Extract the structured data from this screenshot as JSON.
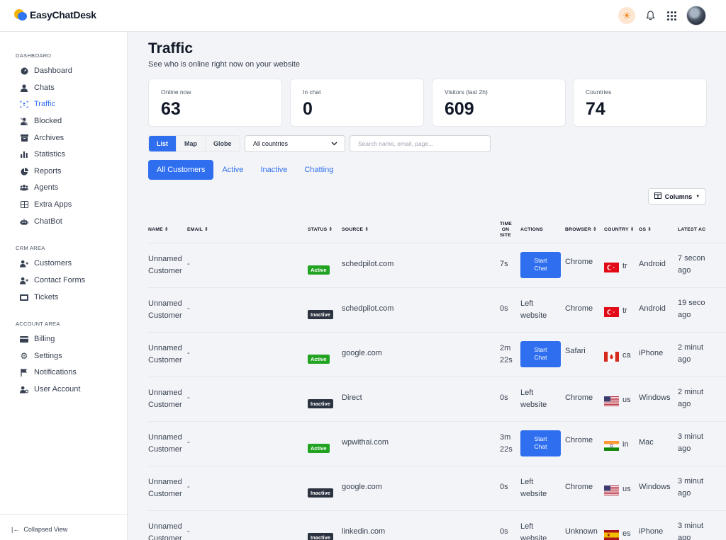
{
  "app": {
    "name": "EasyChatDesk"
  },
  "sidebar": {
    "sections": [
      {
        "title": "DASHBOARD",
        "items": [
          {
            "label": "Dashboard",
            "icon": "gauge-icon"
          },
          {
            "label": "Chats",
            "icon": "user-icon"
          },
          {
            "label": "Traffic",
            "icon": "traffic-icon",
            "active": true
          },
          {
            "label": "Blocked",
            "icon": "user-slash-icon"
          },
          {
            "label": "Archives",
            "icon": "archive-icon"
          },
          {
            "label": "Statistics",
            "icon": "bar-chart-icon"
          },
          {
            "label": "Reports",
            "icon": "pie-chart-icon"
          },
          {
            "label": "Agents",
            "icon": "users-icon"
          },
          {
            "label": "Extra Apps",
            "icon": "grid-box-icon"
          },
          {
            "label": "ChatBot",
            "icon": "robot-icon"
          }
        ]
      },
      {
        "title": "CRM AREA",
        "items": [
          {
            "label": "Customers",
            "icon": "user-plus-icon"
          },
          {
            "label": "Contact Forms",
            "icon": "user-plus-icon"
          },
          {
            "label": "Tickets",
            "icon": "ticket-icon"
          }
        ]
      },
      {
        "title": "ACCOUNT AREA",
        "items": [
          {
            "label": "Billing",
            "icon": "credit-card-icon"
          },
          {
            "label": "Settings",
            "icon": "gear-icon"
          },
          {
            "label": "Notifications",
            "icon": "flag-icon"
          },
          {
            "label": "User Account",
            "icon": "user-gear-icon"
          }
        ]
      }
    ],
    "collapse_label": "Collapsed View"
  },
  "page": {
    "title": "Traffic",
    "subtitle": "See who is online right now on your website"
  },
  "stats": [
    {
      "label": "Online now",
      "value": "63"
    },
    {
      "label": "In chat",
      "value": "0"
    },
    {
      "label": "Visitors (last 2h)",
      "value": "609"
    },
    {
      "label": "Countries",
      "value": "74"
    }
  ],
  "view_toggle": {
    "list": "List",
    "map": "Map",
    "globe": "Globe"
  },
  "country_filter": {
    "value": "All countries"
  },
  "search": {
    "placeholder": "Search name, email, page..."
  },
  "tabs": {
    "all": "All Customers",
    "active": "Active",
    "inactive": "Inactive",
    "chatting": "Chatting"
  },
  "columns_button": "Columns",
  "table": {
    "headers": {
      "name": "NAME ⇕",
      "email": "EMAIL ⇕",
      "status": "STATUS ⇕",
      "source": "SOURCE ⇕",
      "time1": "TIME",
      "time2": "ON",
      "time3": "SITE",
      "actions": "ACTIONS",
      "browser": "BROWSER ⇕",
      "country": "COUNTRY ⇕",
      "os": "OS ⇕",
      "latest": "LATEST AC"
    },
    "rows": [
      {
        "name1": "Unnamed",
        "name2": "Customer",
        "email": "-",
        "status": "Active",
        "source": "schedpilot.com",
        "time1": "7s",
        "time2": "",
        "action1": "Start",
        "action2": "Chat",
        "browser": "Chrome",
        "country": "tr",
        "os": "Android",
        "latest1": "7 secon",
        "latest2": "ago"
      },
      {
        "name1": "Unnamed",
        "name2": "Customer",
        "email": "-",
        "status": "Inactive",
        "source": "schedpilot.com",
        "time1": "0s",
        "time2": "",
        "action1": "Left",
        "action2": "website",
        "browser": "Chrome",
        "country": "tr",
        "os": "Android",
        "latest1": "19 seco",
        "latest2": "ago"
      },
      {
        "name1": "Unnamed",
        "name2": "Customer",
        "email": "-",
        "status": "Active",
        "source": "google.com",
        "time1": "2m",
        "time2": "22s",
        "action1": "Start",
        "action2": "Chat",
        "browser": "Safari",
        "country": "ca",
        "os": "iPhone",
        "latest1": "2 minut",
        "latest2": "ago"
      },
      {
        "name1": "Unnamed",
        "name2": "Customer",
        "email": "-",
        "status": "Inactive",
        "source": "Direct",
        "time1": "0s",
        "time2": "",
        "action1": "Left",
        "action2": "website",
        "browser": "Chrome",
        "country": "us",
        "os": "Windows",
        "latest1": "2 minut",
        "latest2": "ago"
      },
      {
        "name1": "Unnamed",
        "name2": "Customer",
        "email": "-",
        "status": "Active",
        "source": "wpwithai.com",
        "time1": "3m",
        "time2": "22s",
        "action1": "Start",
        "action2": "Chat",
        "browser": "Chrome",
        "country": "in",
        "os": "Mac",
        "latest1": "3 minut",
        "latest2": "ago"
      },
      {
        "name1": "Unnamed",
        "name2": "Customer",
        "email": "-",
        "status": "Inactive",
        "source": "google.com",
        "time1": "0s",
        "time2": "",
        "action1": "Left",
        "action2": "website",
        "browser": "Chrome",
        "country": "us",
        "os": "Windows",
        "latest1": "3 minut",
        "latest2": "ago"
      },
      {
        "name1": "Unnamed",
        "name2": "Customer",
        "email": "-",
        "status": "Inactive",
        "source": "linkedin.com",
        "time1": "0s",
        "time2": "",
        "action1": "Left",
        "action2": "website",
        "browser": "Unknown",
        "country": "es",
        "os": "iPhone",
        "latest1": "3 minut",
        "latest2": "ago"
      }
    ]
  },
  "colors": {
    "primary": "#2f6fef",
    "active_badge": "#22a322",
    "inactive_badge": "#2b3340"
  }
}
